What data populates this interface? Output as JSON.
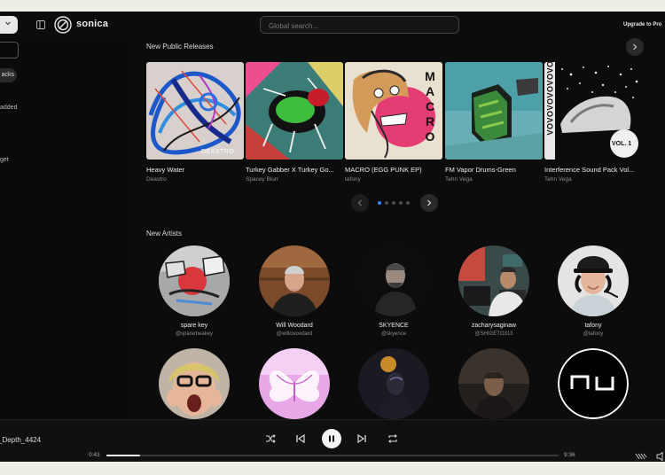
{
  "app": {
    "name": "sonica"
  },
  "header": {
    "search_placeholder": "Global search...",
    "upgrade_label": "Upgrade to Pro"
  },
  "sidebar": {
    "chip_label": "acks",
    "added_label": "added",
    "target_label": "get"
  },
  "releases": {
    "title": "New Public Releases",
    "items": [
      {
        "title": "Heavy Water",
        "artist": "Deastro",
        "cover_text": "DEASTRO"
      },
      {
        "title": "Turkey Gabber X Turkey Go...",
        "artist": "Spacey Blurr"
      },
      {
        "title": "MACRO (EGG PUNK EP)",
        "artist": "tafony",
        "cover_text": "MACRO"
      },
      {
        "title": "FM Vapor Drums-Green",
        "artist": "Tehn Vega"
      },
      {
        "title": "Interference Sound Pack Vol...",
        "artist": "Tehn Vega",
        "cover_text": "VOL. 1",
        "cover_side": "OΛOΛOΛOΛOΛOΛ"
      }
    ],
    "page_count": 5,
    "active_page": 1
  },
  "artists": {
    "title": "New Artists",
    "items": [
      {
        "name": "spare key",
        "handle": "@sparemeakey"
      },
      {
        "name": "Will Woodard",
        "handle": "@willcwoodard"
      },
      {
        "name": "SKYENCE",
        "handle": "@skyence"
      },
      {
        "name": "zacharysaginaw",
        "handle": "@SHIGETO313"
      },
      {
        "name": "tafony",
        "handle": "@tafony"
      },
      {
        "name": "",
        "handle": ""
      },
      {
        "name": "",
        "handle": ""
      },
      {
        "name": "",
        "handle": ""
      },
      {
        "name": "",
        "handle": ""
      },
      {
        "name": "",
        "handle": "",
        "logo_text": "ɲ ɹ"
      }
    ]
  },
  "player": {
    "track": "_Depth_4424",
    "elapsed": "0:43",
    "duration": "9:36",
    "progress_fraction": 0.075
  },
  "icons": [
    "chevron-down-icon",
    "sidebar-toggle-icon",
    "logo-icon",
    "chevron-right-icon",
    "chevron-left-icon",
    "shuffle-icon",
    "previous-icon",
    "pause-icon",
    "next-icon",
    "repeat-icon",
    "queue-icon",
    "volume-icon"
  ]
}
